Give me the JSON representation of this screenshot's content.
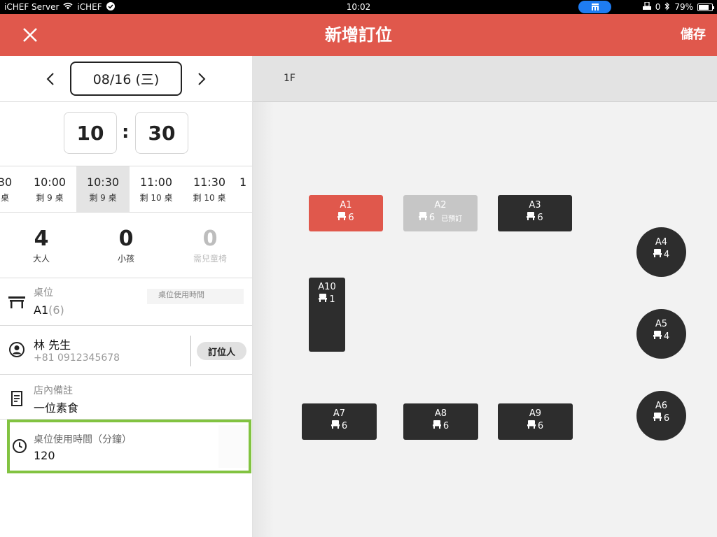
{
  "status_bar": {
    "carrier": "iCHEF Server",
    "wifi_name": "iCHEF",
    "time": "10:02",
    "dnd_count": "0",
    "battery": "79%",
    "battery_level": 0.79
  },
  "header": {
    "title": "新增訂位",
    "save_label": "儲存"
  },
  "date": {
    "value": "08/16 (三)"
  },
  "time": {
    "hour": "10",
    "colon": ":",
    "minute": "30"
  },
  "time_slots": [
    {
      "time": "30",
      "remaining": "桌"
    },
    {
      "time": "10:00",
      "remaining": "剩 9 桌"
    },
    {
      "time": "10:30",
      "remaining": "剩 9 桌",
      "selected": true
    },
    {
      "time": "11:00",
      "remaining": "剩 10 桌"
    },
    {
      "time": "11:30",
      "remaining": "剩 10 桌"
    },
    {
      "time": "1",
      "remaining": ""
    }
  ],
  "party": {
    "adults": {
      "count": "4",
      "label": "大人"
    },
    "children": {
      "count": "0",
      "label": "小孩"
    },
    "high_chairs": {
      "count": "0",
      "label": "需兒童椅"
    }
  },
  "table_field": {
    "label": "桌位",
    "value": "A1",
    "capacity": "(6)",
    "ghost_label": "桌位使用時間"
  },
  "customer": {
    "name": "林 先生",
    "phone": "+81 0912345678",
    "booker_label": "訂位人"
  },
  "note": {
    "label": "店內備註",
    "value": "一位素食"
  },
  "duration": {
    "label": "桌位使用時間（分鐘）",
    "value": "120"
  },
  "floor": {
    "tab": "1F",
    "tables": [
      {
        "id": "A1",
        "seats": "6",
        "status": "selected",
        "shape": "rect"
      },
      {
        "id": "A2",
        "seats": "6",
        "status": "booked",
        "booked_label": "已預訂",
        "shape": "rect"
      },
      {
        "id": "A3",
        "seats": "6",
        "status": "available",
        "shape": "rect"
      },
      {
        "id": "A4",
        "seats": "4",
        "status": "available",
        "shape": "round"
      },
      {
        "id": "A5",
        "seats": "4",
        "status": "available",
        "shape": "round"
      },
      {
        "id": "A6",
        "seats": "6",
        "status": "available",
        "shape": "round"
      },
      {
        "id": "A7",
        "seats": "6",
        "status": "available",
        "shape": "rect"
      },
      {
        "id": "A8",
        "seats": "6",
        "status": "available",
        "shape": "rect"
      },
      {
        "id": "A9",
        "seats": "6",
        "status": "available",
        "shape": "rect"
      },
      {
        "id": "A10",
        "seats": "1",
        "status": "available",
        "shape": "tall"
      }
    ]
  },
  "colors": {
    "accent": "#e0584c",
    "booked": "#c6c6c6",
    "table": "#2d2d2d",
    "highlight": "#82c341"
  },
  "icons": [
    "close-icon",
    "chevron-left-icon",
    "chevron-right-icon",
    "table-icon",
    "user-icon",
    "note-icon",
    "clock-icon",
    "chair-icon",
    "wifi-icon",
    "check-icon",
    "bluetooth-icon",
    "battery-icon"
  ]
}
